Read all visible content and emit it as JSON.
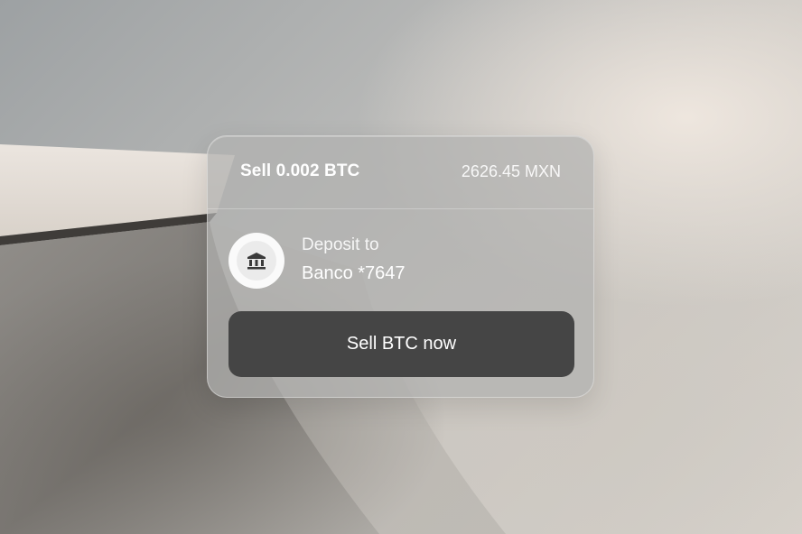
{
  "order": {
    "title": "Sell 0.002 BTC",
    "amount": "2626.45 MXN"
  },
  "deposit": {
    "label": "Deposit to",
    "account": "Banco *7647",
    "icon": "bank-icon"
  },
  "actions": {
    "sell_label": "Sell BTC now"
  },
  "colors": {
    "button_bg": "#454545",
    "text": "#ffffff"
  }
}
